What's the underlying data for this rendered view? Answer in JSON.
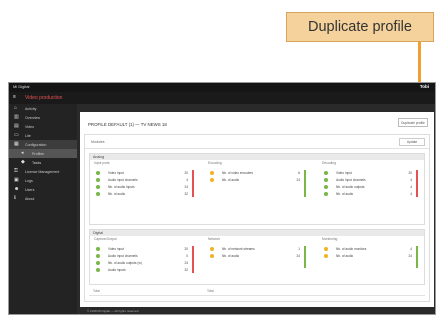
{
  "callout": {
    "label": "Duplicate profile"
  },
  "topbar": {
    "title": "Mi Digital",
    "user": "Tobi"
  },
  "app": {
    "name": "Video production"
  },
  "sidebar": {
    "items": [
      {
        "label": "Activity",
        "icon": "home-icon"
      },
      {
        "label": "Overview",
        "icon": "chart-icon"
      },
      {
        "label": "Video",
        "icon": "video-icon"
      },
      {
        "label": "Lite",
        "icon": "monitor-icon"
      },
      {
        "label": "Configuration",
        "icon": "settings-icon"
      },
      {
        "label": "Profiles",
        "icon": "profile-icon",
        "sub": true
      },
      {
        "label": "Tasks",
        "icon": "task-icon",
        "sub": true
      },
      {
        "label": "Licence Management",
        "icon": "key-icon"
      },
      {
        "label": "Logs",
        "icon": "log-icon"
      },
      {
        "label": "Users",
        "icon": "users-icon"
      },
      {
        "label": "About",
        "icon": "info-icon"
      }
    ]
  },
  "content": {
    "header": "PROFILE DEFAULT (1) — TV NEWS 18",
    "duplicate_button": "Duplicate profile",
    "panel_label": "Modules",
    "update_button": "Update"
  },
  "sections": [
    {
      "title": "Analog",
      "columns": [
        {
          "name": "Input ports",
          "rows": [
            {
              "label": "Video input",
              "value": "20",
              "status": "green"
            },
            {
              "label": "Audio input channels",
              "value": "4",
              "status": "green"
            },
            {
              "label": "Nb. of audio inputs",
              "value": "24",
              "status": "green"
            },
            {
              "label": "Nb. of audio",
              "value": "32",
              "status": "green"
            }
          ]
        },
        {
          "name": "Encoding",
          "rows": [
            {
              "label": "Nb. of video encoders",
              "value": "6",
              "status": "yellow"
            },
            {
              "label": "Nb. of audio",
              "value": "24",
              "status": "yellow"
            }
          ]
        },
        {
          "name": "Decoding",
          "rows": [
            {
              "label": "Video input",
              "value": "20",
              "status": "green"
            },
            {
              "label": "Audio input channels",
              "value": "4",
              "status": "green"
            },
            {
              "label": "Nb. of audio outputs",
              "value": "4",
              "status": "green"
            },
            {
              "label": "Nb. of audio",
              "value": "4",
              "status": "green"
            }
          ]
        }
      ]
    },
    {
      "title": "Digital",
      "columns": [
        {
          "name": "Capture/Output",
          "rows": [
            {
              "label": "Video input",
              "value": "20",
              "status": "green"
            },
            {
              "label": "Audio input channels",
              "value": "0",
              "status": "green"
            },
            {
              "label": "Nb. of audio outputs (w)",
              "value": "24",
              "status": "green"
            },
            {
              "label": "Audio inputs",
              "value": "32",
              "status": "green"
            }
          ]
        },
        {
          "name": "Network",
          "rows": [
            {
              "label": "Nb. of network streams",
              "value": "1",
              "status": "yellow"
            },
            {
              "label": "Nb. of audio",
              "value": "24",
              "status": "yellow"
            }
          ]
        },
        {
          "name": "Monitoring",
          "rows": [
            {
              "label": "Nb. of audio monitors",
              "value": "4",
              "status": "yellow"
            },
            {
              "label": "Nb. of audio",
              "value": "24",
              "status": "yellow"
            }
          ]
        }
      ]
    }
  ],
  "extra_labels": {
    "left": "Total",
    "mid": "Total"
  },
  "footer": "© 2018 Mi Digital — All rights reserved",
  "colors": {
    "accent": "#e35252",
    "callout_bg": "#f5d29b",
    "arrow": "#f0a030",
    "status_green": "#7ab648",
    "status_yellow": "#f0b323"
  }
}
